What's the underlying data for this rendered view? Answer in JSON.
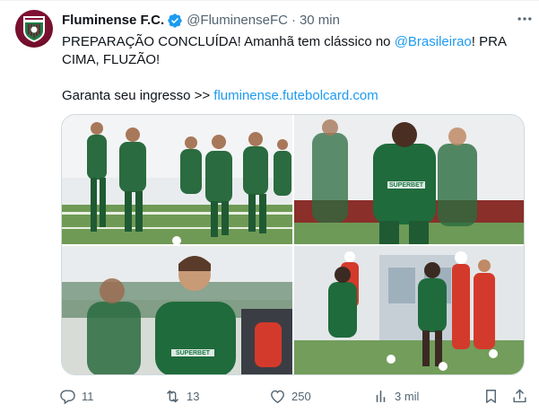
{
  "tweet": {
    "author_name": "Fluminense F.C.",
    "handle": "@FluminenseFC",
    "separator": "·",
    "time": "30 min",
    "text_part1": "PREPARAÇÃO CONCLUÍDA! Amanhã tem clássico no ",
    "mention": "@Brasileirao",
    "text_part2": "! PRA CIMA, FLUZÃO!",
    "ticket_text": "Garanta seu ingresso >> ",
    "ticket_link": "fluminense.futebolcard.com"
  },
  "actions": {
    "replies": "11",
    "reposts": "13",
    "likes": "250",
    "views": "3 mil"
  },
  "photos": {
    "sponsor_label": "SUPERBET"
  },
  "colors": {
    "link": "#1d9bf0",
    "text": "#0f1419",
    "muted": "#536471",
    "club_green": "#1e7a45",
    "club_maroon": "#7a1030"
  },
  "icons": [
    "verified-badge-icon",
    "more-options-icon",
    "reply-icon",
    "repost-icon",
    "like-icon",
    "views-icon",
    "bookmark-icon",
    "share-icon"
  ]
}
